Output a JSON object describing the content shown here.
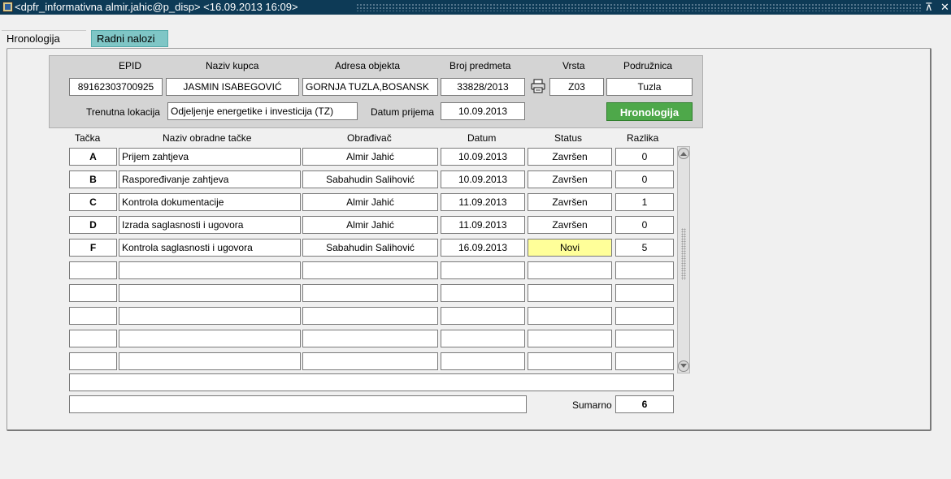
{
  "window": {
    "title": "<dpfr_informativna almir.jahic@p_disp> <16.09.2013 16:09>",
    "restore_glyph": "⊼",
    "close_glyph": "✕"
  },
  "tabs": [
    {
      "label": "Hronologija",
      "active": true
    },
    {
      "label": "Radni nalozi",
      "active": false
    }
  ],
  "header": {
    "labels": {
      "epid": "EPID",
      "naziv_kupca": "Naziv kupca",
      "adresa_objekta": "Adresa objekta",
      "broj_predmeta": "Broj predmeta",
      "vrsta": "Vrsta",
      "podruznica": "Podružnica",
      "trenutna_lokacija": "Trenutna lokacija",
      "datum_prijema": "Datum prijema"
    },
    "values": {
      "epid": "89162303700925",
      "naziv_kupca": "JASMIN ISABEGOVIĆ",
      "adresa_objekta": "GORNJA TUZLA,BOSANSK",
      "broj_predmeta": "33828/2013",
      "vrsta": "Z03",
      "podruznica": "Tuzla",
      "trenutna_lokacija": "Odjeljenje energetike i investicija (TZ)",
      "datum_prijema": "10.09.2013"
    },
    "button": "Hronologija",
    "print_icon": "printer-icon"
  },
  "table": {
    "columns": [
      "Tačka",
      "Naziv obradne tačke",
      "Obrađivač",
      "Datum",
      "Status",
      "Razlika"
    ],
    "rows": [
      {
        "tacka": "A",
        "naziv": "Prijem zahtjeva",
        "obradjivac": "Almir Jahić",
        "datum": "10.09.2013",
        "status": "Završen",
        "razlika": "0"
      },
      {
        "tacka": "B",
        "naziv": "Raspoređivanje zahtjeva",
        "obradjivac": "Sabahudin Salihović",
        "datum": "10.09.2013",
        "status": "Završen",
        "razlika": "0"
      },
      {
        "tacka": "C",
        "naziv": "Kontrola dokumentacije",
        "obradjivac": "Almir Jahić",
        "datum": "11.09.2013",
        "status": "Završen",
        "razlika": "1"
      },
      {
        "tacka": "D",
        "naziv": "Izrada saglasnosti i ugovora",
        "obradjivac": "Almir Jahić",
        "datum": "11.09.2013",
        "status": "Završen",
        "razlika": "0"
      },
      {
        "tacka": "F",
        "naziv": "Kontrola saglasnosti i ugovora",
        "obradjivac": "Sabahudin Salihović",
        "datum": "16.09.2013",
        "status": "Novi",
        "razlika": "5"
      },
      {
        "tacka": "",
        "naziv": "",
        "obradjivac": "",
        "datum": "",
        "status": "",
        "razlika": ""
      },
      {
        "tacka": "",
        "naziv": "",
        "obradjivac": "",
        "datum": "",
        "status": "",
        "razlika": ""
      },
      {
        "tacka": "",
        "naziv": "",
        "obradjivac": "",
        "datum": "",
        "status": "",
        "razlika": ""
      },
      {
        "tacka": "",
        "naziv": "",
        "obradjivac": "",
        "datum": "",
        "status": "",
        "razlika": ""
      },
      {
        "tacka": "",
        "naziv": "",
        "obradjivac": "",
        "datum": "",
        "status": "",
        "razlika": ""
      }
    ],
    "highlight_status_color": "#ffff99"
  },
  "footer": {
    "note_value": "",
    "extra_value": "",
    "sumarno_label": "Sumarno",
    "sumarno_value": "6"
  }
}
